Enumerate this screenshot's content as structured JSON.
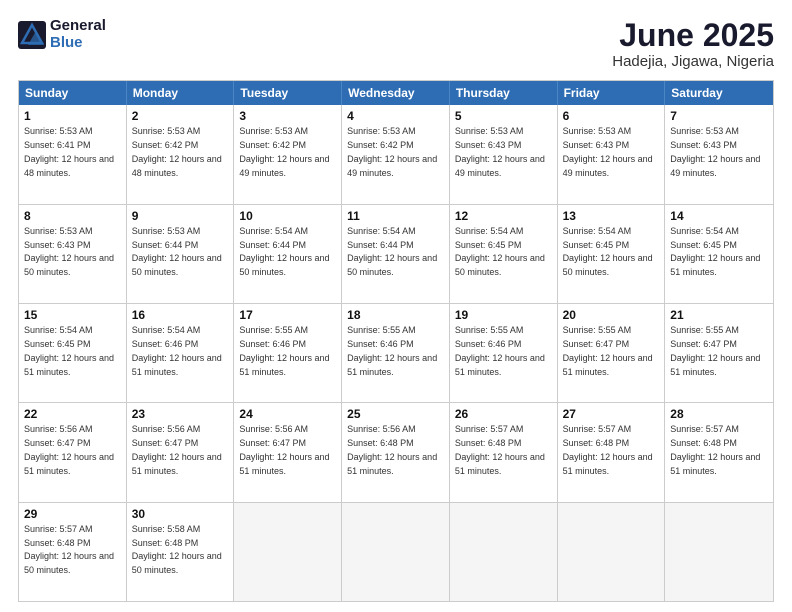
{
  "header": {
    "logo_general": "General",
    "logo_blue": "Blue",
    "title": "June 2025",
    "subtitle": "Hadejia, Jigawa, Nigeria"
  },
  "days_of_week": [
    "Sunday",
    "Monday",
    "Tuesday",
    "Wednesday",
    "Thursday",
    "Friday",
    "Saturday"
  ],
  "weeks": [
    [
      {
        "day": "1",
        "sunrise": "5:53 AM",
        "sunset": "6:41 PM",
        "daylight": "12 hours and 48 minutes."
      },
      {
        "day": "2",
        "sunrise": "5:53 AM",
        "sunset": "6:42 PM",
        "daylight": "12 hours and 48 minutes."
      },
      {
        "day": "3",
        "sunrise": "5:53 AM",
        "sunset": "6:42 PM",
        "daylight": "12 hours and 49 minutes."
      },
      {
        "day": "4",
        "sunrise": "5:53 AM",
        "sunset": "6:42 PM",
        "daylight": "12 hours and 49 minutes."
      },
      {
        "day": "5",
        "sunrise": "5:53 AM",
        "sunset": "6:43 PM",
        "daylight": "12 hours and 49 minutes."
      },
      {
        "day": "6",
        "sunrise": "5:53 AM",
        "sunset": "6:43 PM",
        "daylight": "12 hours and 49 minutes."
      },
      {
        "day": "7",
        "sunrise": "5:53 AM",
        "sunset": "6:43 PM",
        "daylight": "12 hours and 49 minutes."
      }
    ],
    [
      {
        "day": "8",
        "sunrise": "5:53 AM",
        "sunset": "6:43 PM",
        "daylight": "12 hours and 50 minutes."
      },
      {
        "day": "9",
        "sunrise": "5:53 AM",
        "sunset": "6:44 PM",
        "daylight": "12 hours and 50 minutes."
      },
      {
        "day": "10",
        "sunrise": "5:54 AM",
        "sunset": "6:44 PM",
        "daylight": "12 hours and 50 minutes."
      },
      {
        "day": "11",
        "sunrise": "5:54 AM",
        "sunset": "6:44 PM",
        "daylight": "12 hours and 50 minutes."
      },
      {
        "day": "12",
        "sunrise": "5:54 AM",
        "sunset": "6:45 PM",
        "daylight": "12 hours and 50 minutes."
      },
      {
        "day": "13",
        "sunrise": "5:54 AM",
        "sunset": "6:45 PM",
        "daylight": "12 hours and 50 minutes."
      },
      {
        "day": "14",
        "sunrise": "5:54 AM",
        "sunset": "6:45 PM",
        "daylight": "12 hours and 51 minutes."
      }
    ],
    [
      {
        "day": "15",
        "sunrise": "5:54 AM",
        "sunset": "6:45 PM",
        "daylight": "12 hours and 51 minutes."
      },
      {
        "day": "16",
        "sunrise": "5:54 AM",
        "sunset": "6:46 PM",
        "daylight": "12 hours and 51 minutes."
      },
      {
        "day": "17",
        "sunrise": "5:55 AM",
        "sunset": "6:46 PM",
        "daylight": "12 hours and 51 minutes."
      },
      {
        "day": "18",
        "sunrise": "5:55 AM",
        "sunset": "6:46 PM",
        "daylight": "12 hours and 51 minutes."
      },
      {
        "day": "19",
        "sunrise": "5:55 AM",
        "sunset": "6:46 PM",
        "daylight": "12 hours and 51 minutes."
      },
      {
        "day": "20",
        "sunrise": "5:55 AM",
        "sunset": "6:47 PM",
        "daylight": "12 hours and 51 minutes."
      },
      {
        "day": "21",
        "sunrise": "5:55 AM",
        "sunset": "6:47 PM",
        "daylight": "12 hours and 51 minutes."
      }
    ],
    [
      {
        "day": "22",
        "sunrise": "5:56 AM",
        "sunset": "6:47 PM",
        "daylight": "12 hours and 51 minutes."
      },
      {
        "day": "23",
        "sunrise": "5:56 AM",
        "sunset": "6:47 PM",
        "daylight": "12 hours and 51 minutes."
      },
      {
        "day": "24",
        "sunrise": "5:56 AM",
        "sunset": "6:47 PM",
        "daylight": "12 hours and 51 minutes."
      },
      {
        "day": "25",
        "sunrise": "5:56 AM",
        "sunset": "6:48 PM",
        "daylight": "12 hours and 51 minutes."
      },
      {
        "day": "26",
        "sunrise": "5:57 AM",
        "sunset": "6:48 PM",
        "daylight": "12 hours and 51 minutes."
      },
      {
        "day": "27",
        "sunrise": "5:57 AM",
        "sunset": "6:48 PM",
        "daylight": "12 hours and 51 minutes."
      },
      {
        "day": "28",
        "sunrise": "5:57 AM",
        "sunset": "6:48 PM",
        "daylight": "12 hours and 51 minutes."
      }
    ],
    [
      {
        "day": "29",
        "sunrise": "5:57 AM",
        "sunset": "6:48 PM",
        "daylight": "12 hours and 50 minutes."
      },
      {
        "day": "30",
        "sunrise": "5:58 AM",
        "sunset": "6:48 PM",
        "daylight": "12 hours and 50 minutes."
      },
      {
        "day": "",
        "sunrise": "",
        "sunset": "",
        "daylight": ""
      },
      {
        "day": "",
        "sunrise": "",
        "sunset": "",
        "daylight": ""
      },
      {
        "day": "",
        "sunrise": "",
        "sunset": "",
        "daylight": ""
      },
      {
        "day": "",
        "sunrise": "",
        "sunset": "",
        "daylight": ""
      },
      {
        "day": "",
        "sunrise": "",
        "sunset": "",
        "daylight": ""
      }
    ]
  ],
  "labels": {
    "sunrise": "Sunrise:",
    "sunset": "Sunset:",
    "daylight": "Daylight:"
  }
}
